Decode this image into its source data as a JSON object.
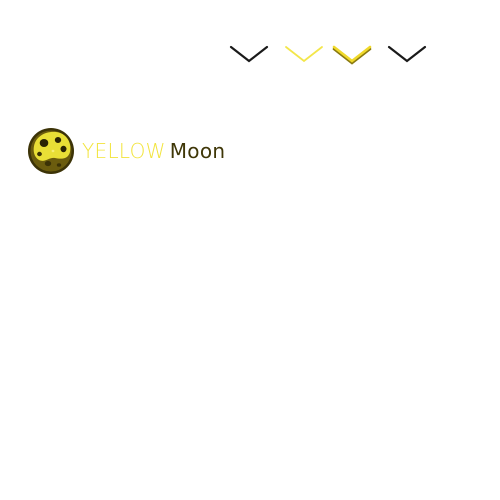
{
  "chevrons": [
    {
      "icon": "chevron-down-icon",
      "color": "#1a1a1a",
      "style": "outline-thin"
    },
    {
      "icon": "chevron-down-icon",
      "color": "#f3e64a",
      "style": "outline-thin"
    },
    {
      "icon": "chevron-down-icon",
      "color": "#f0d92a",
      "style": "outline-bold-with-shadow",
      "shadow": "#8a7a10"
    },
    {
      "icon": "chevron-down-icon",
      "color": "#1a1a1a",
      "style": "outline-thin"
    }
  ],
  "logo": {
    "icon": "moon-icon",
    "word_yellow": "YELLOW",
    "word_moon": "Moon",
    "colors": {
      "yellow_text": "#f2e43c",
      "moon_text": "#3f3708",
      "moon_face": "#e9df36",
      "moon_dark": "#5a4d0c",
      "moon_rim": "#3c3307",
      "crater": "#2b2404"
    }
  }
}
